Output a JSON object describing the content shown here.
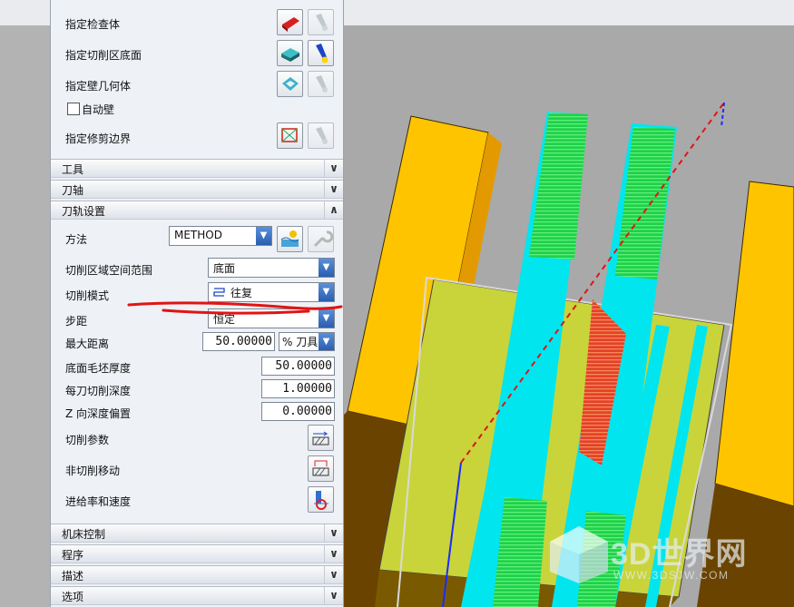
{
  "panel": {
    "geometry_rows": [
      {
        "id": "check-body",
        "label": "指定检查体"
      },
      {
        "id": "cut-floor",
        "label": "指定切削区底面"
      },
      {
        "id": "wall-geometry",
        "label": "指定壁几何体"
      }
    ],
    "auto_wall_label": "自动壁",
    "trim_boundary_label": "指定修剪边界",
    "sections_top": [
      {
        "id": "tool",
        "label": "工具",
        "chev": "∨"
      },
      {
        "id": "axis",
        "label": "刀轴",
        "chev": "∨"
      },
      {
        "id": "path",
        "label": "刀轨设置",
        "chev": "∧"
      }
    ],
    "method_label": "方法",
    "method_value": "METHOD",
    "cut_region_label": "切削区域空间范围",
    "cut_region_value": "底面",
    "cut_pattern_label": "切削模式",
    "cut_pattern_value": "往复",
    "stepover_label": "步距",
    "stepover_value": "恒定",
    "max_dist_label": "最大距离",
    "max_dist_value": "50.00000",
    "max_dist_unit": "% 刀具",
    "floor_stock_label": "底面毛坯厚度",
    "floor_stock_value": "50.00000",
    "depth_per_cut_label": "每刀切削深度",
    "depth_per_cut_value": "1.00000",
    "z_offset_label": "Z 向深度偏置",
    "z_offset_value": "0.00000",
    "cut_params_label": "切削参数",
    "non_cut_label": "非切削移动",
    "feeds_label": "进给率和速度",
    "sections_bottom": [
      {
        "id": "machine",
        "label": "机床控制",
        "chev": "∨"
      },
      {
        "id": "program",
        "label": "程序",
        "chev": "∨"
      },
      {
        "id": "desc",
        "label": "描述",
        "chev": "∨"
      },
      {
        "id": "options",
        "label": "选项",
        "chev": "∨"
      }
    ]
  },
  "watermark": {
    "title": "3D世界网",
    "url": "WWW.3DSJW.COM"
  },
  "colors": {
    "accent_red": "#e11414",
    "cyan": "#00e5ee",
    "yellow": "#ffc400",
    "green": "#22d64a",
    "floor": "#c9d43a",
    "brown": "#6b4300"
  }
}
